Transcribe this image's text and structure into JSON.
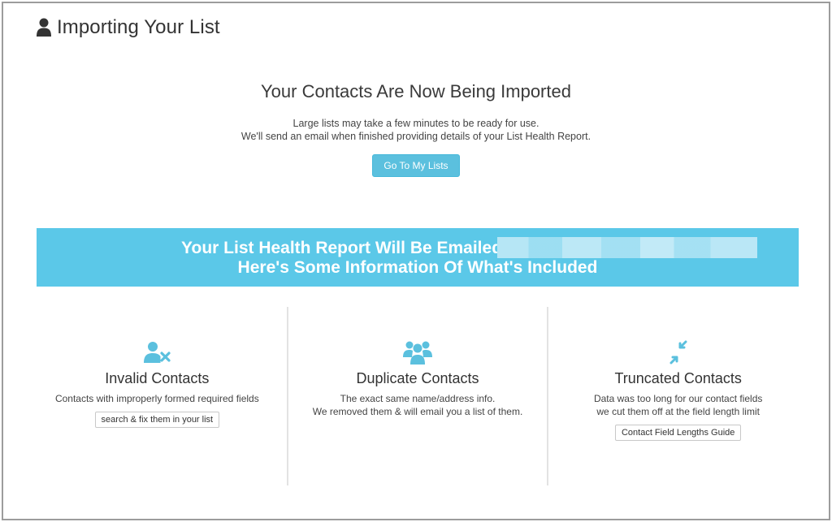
{
  "header": {
    "title": "Importing Your List",
    "icon": "user-icon"
  },
  "hero": {
    "heading": "Your Contacts Are Now Being Imported",
    "line1": "Large lists may take a few minutes to be ready for use.",
    "line2": "We'll send an email when finished providing details of your List Health Report.",
    "button_label": "Go To My Lists"
  },
  "banner": {
    "line1": "Your List Health Report Will Be Emailed To:",
    "line2": "Here's Some Information Of What's Included",
    "color": "#5bc8e8"
  },
  "columns": [
    {
      "icon": "user-remove-icon",
      "title": "Invalid Contacts",
      "desc1": "Contacts with improperly formed required fields",
      "desc2": "",
      "button_label": "search & fix them in your list"
    },
    {
      "icon": "group-icon",
      "title": "Duplicate Contacts",
      "desc1": "The exact same name/address info.",
      "desc2": "We removed them & will email you a list of them."
    },
    {
      "icon": "compress-arrows-icon",
      "title": "Truncated Contacts",
      "desc1": "Data was too long for our contact fields",
      "desc2": "we cut them off at the field length limit",
      "button_label": "Contact Field Lengths Guide"
    }
  ],
  "colors": {
    "accent": "#5bc0de",
    "icon": "#5bc0de"
  }
}
